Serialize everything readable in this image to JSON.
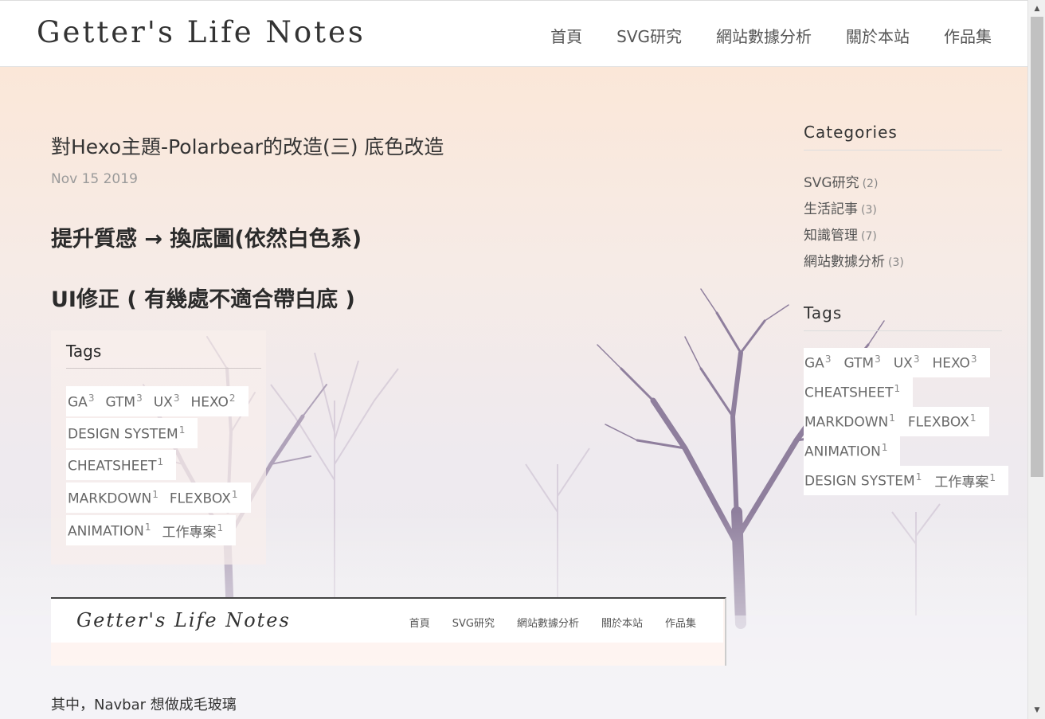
{
  "header": {
    "logo": "Getter's Life Notes",
    "nav": [
      "首頁",
      "SVG研究",
      "網站數據分析",
      "關於本站",
      "作品集"
    ]
  },
  "post": {
    "title": "對Hexo主題-Polarbear的改造(三) 底色改造",
    "date": "Nov 15 2019",
    "heading1": "提升質感 → 換底圖(依然白色系)",
    "heading2": "UI修正 ( 有幾處不適合帶白底 )",
    "body_text": "其中，Navbar 想做成毛玻璃"
  },
  "embedded_tags": {
    "title": "Tags",
    "rows": [
      [
        {
          "name": "GA",
          "count": "3"
        },
        {
          "name": "GTM",
          "count": "3"
        },
        {
          "name": "UX",
          "count": "3"
        },
        {
          "name": "HEXO",
          "count": "2"
        }
      ],
      [
        {
          "name": "DESIGN SYSTEM",
          "count": "1"
        }
      ],
      [
        {
          "name": "CHEATSHEET",
          "count": "1"
        }
      ],
      [
        {
          "name": "MARKDOWN",
          "count": "1"
        },
        {
          "name": "FLEXBOX",
          "count": "1"
        }
      ],
      [
        {
          "name": "ANIMATION",
          "count": "1"
        },
        {
          "name": "工作專案",
          "count": "1"
        }
      ]
    ]
  },
  "embedded_nav": {
    "logo": "Getter's Life Notes",
    "nav": [
      "首頁",
      "SVG研究",
      "網站數據分析",
      "關於本站",
      "作品集"
    ]
  },
  "sidebar": {
    "categories_title": "Categories",
    "categories": [
      {
        "name": "SVG研究",
        "count": "(2)"
      },
      {
        "name": "生活記事",
        "count": "(3)"
      },
      {
        "name": "知識管理",
        "count": "(7)"
      },
      {
        "name": "網站數據分析",
        "count": "(3)"
      }
    ],
    "tags_title": "Tags",
    "tag_rows": [
      [
        {
          "name": "GA",
          "count": "3"
        },
        {
          "name": "GTM",
          "count": "3"
        },
        {
          "name": "UX",
          "count": "3"
        },
        {
          "name": "HEXO",
          "count": "3"
        }
      ],
      [
        {
          "name": "CHEATSHEET",
          "count": "1"
        }
      ],
      [
        {
          "name": "MARKDOWN",
          "count": "1"
        },
        {
          "name": "FLEXBOX",
          "count": "1"
        }
      ],
      [
        {
          "name": "ANIMATION",
          "count": "1"
        }
      ],
      [
        {
          "name": "DESIGN SYSTEM",
          "count": "1"
        },
        {
          "name": "工作專案",
          "count": "1"
        }
      ]
    ]
  },
  "icons": {
    "scroll_up": "scroll-up-arrow-icon",
    "scroll_down": "scroll-down-arrow-icon"
  }
}
